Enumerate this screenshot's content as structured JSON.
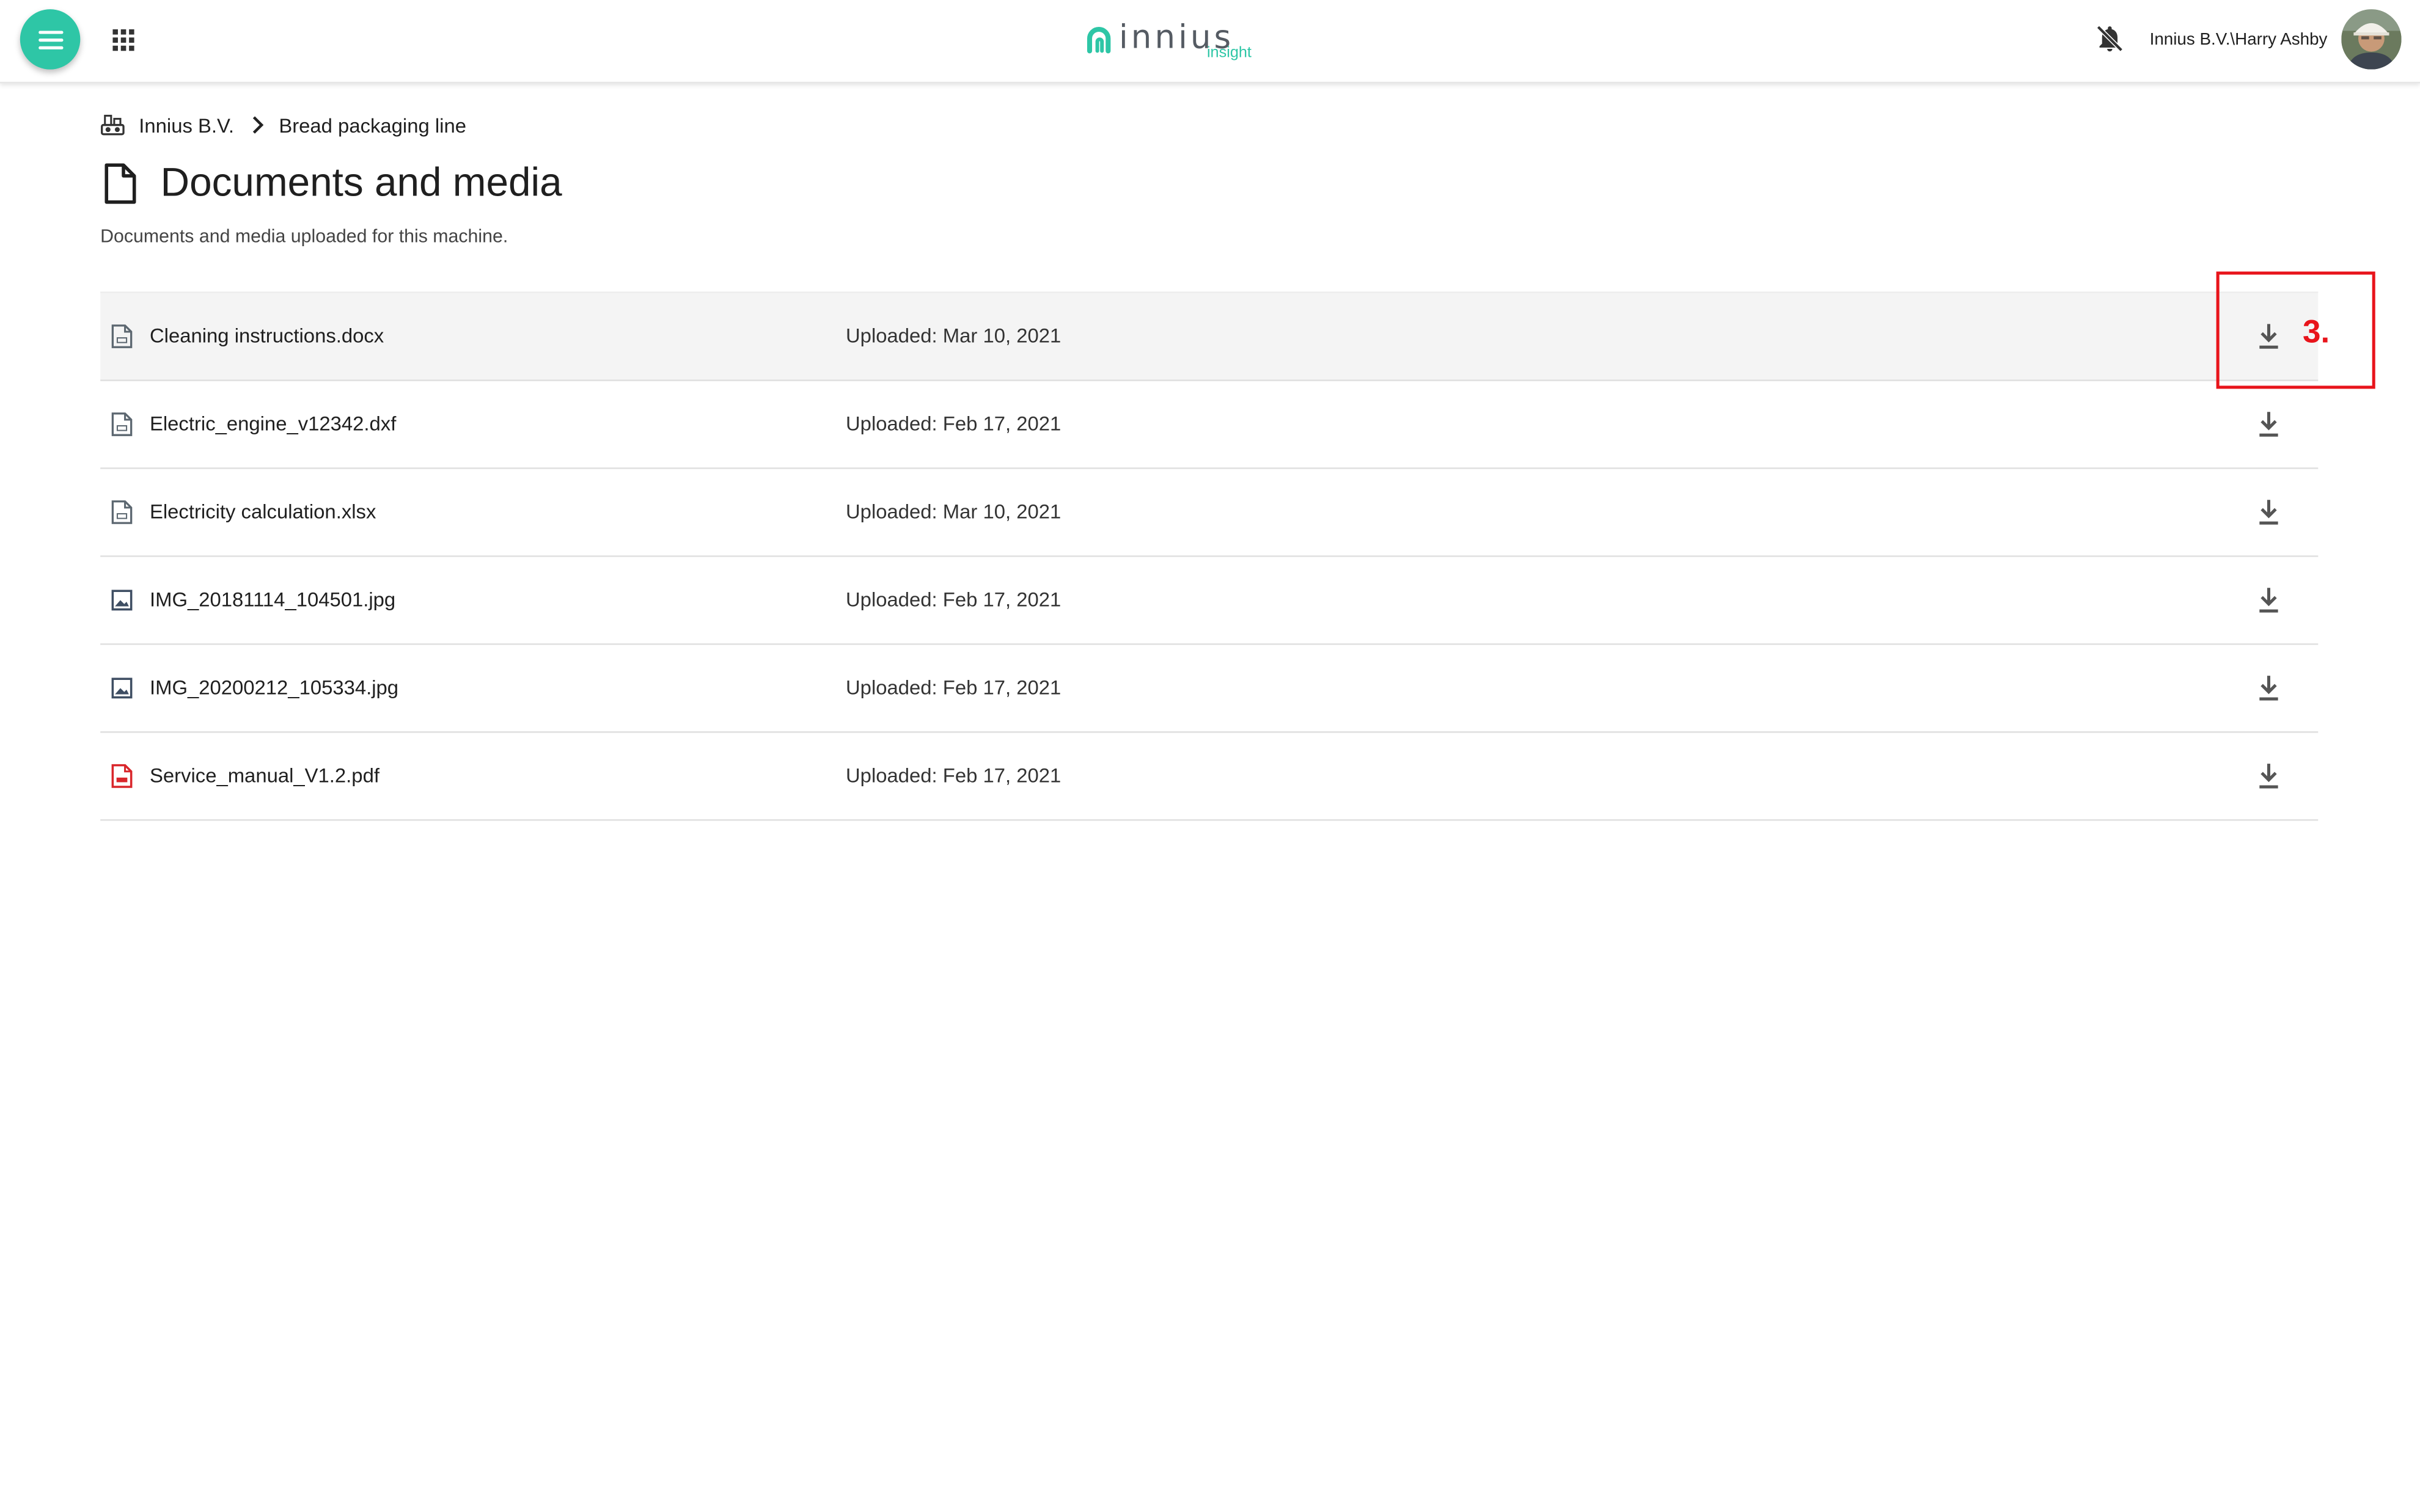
{
  "header": {
    "logo_text": "innius",
    "logo_sub": "insight",
    "user_label": "Innius B.V.\\Harry Ashby",
    "brand_color": "#2ec6a6"
  },
  "breadcrumb": {
    "items": [
      "Innius B.V.",
      "Bread packaging line"
    ]
  },
  "page": {
    "title": "Documents and media",
    "subtitle": "Documents and media uploaded for this machine."
  },
  "documents": [
    {
      "name": "Cleaning instructions.docx",
      "uploaded": "Uploaded: Mar 10, 2021",
      "icon": "file-icon"
    },
    {
      "name": "Electric_engine_v12342.dxf",
      "uploaded": "Uploaded: Feb 17, 2021",
      "icon": "file-icon"
    },
    {
      "name": "Electricity calculation.xlsx",
      "uploaded": "Uploaded: Mar 10, 2021",
      "icon": "file-icon"
    },
    {
      "name": "IMG_20181114_104501.jpg",
      "uploaded": "Uploaded: Feb 17, 2021",
      "icon": "image-icon"
    },
    {
      "name": "IMG_20200212_105334.jpg",
      "uploaded": "Uploaded: Feb 17, 2021",
      "icon": "image-icon"
    },
    {
      "name": "Service_manual_V1.2.pdf",
      "uploaded": "Uploaded: Feb 17, 2021",
      "icon": "pdf-icon"
    }
  ],
  "annotation": {
    "label": "3.",
    "color": "#e8141b"
  }
}
